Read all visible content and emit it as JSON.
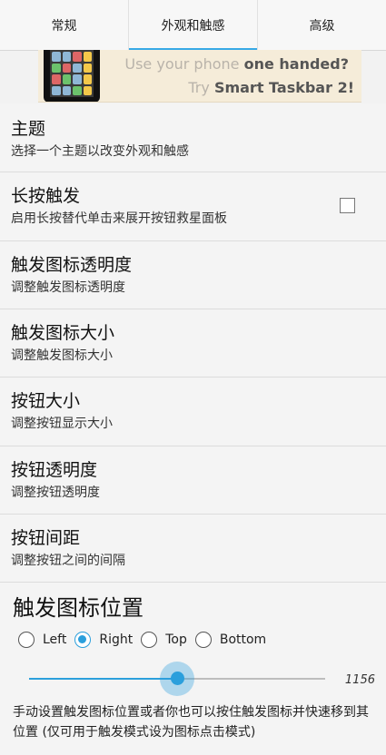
{
  "tabs": [
    {
      "label": "常规",
      "active": false
    },
    {
      "label": "外观和触感",
      "active": true
    },
    {
      "label": "高级",
      "active": false
    }
  ],
  "banner": {
    "line1_prefix": "Use your phone ",
    "line1_bold": "one handed?",
    "line2_prefix": "Try ",
    "line2_bold": "Smart Taskbar 2!"
  },
  "settings": [
    {
      "title": "主题",
      "subtitle": "选择一个主题以改变外观和触感"
    },
    {
      "title": "长按触发",
      "subtitle": "启用长按替代单击来展开按钮救星面板",
      "checkbox": false
    },
    {
      "title": "触发图标透明度",
      "subtitle": "调整触发图标透明度"
    },
    {
      "title": "触发图标大小",
      "subtitle": "调整触发图标大小"
    },
    {
      "title": "按钮大小",
      "subtitle": "调整按钮显示大小"
    },
    {
      "title": "按钮透明度",
      "subtitle": "调整按钮透明度"
    },
    {
      "title": "按钮间距",
      "subtitle": "调整按钮之间的间隔"
    }
  ],
  "position_section": {
    "title": "触发图标位置",
    "options": [
      "Left",
      "Right",
      "Top",
      "Bottom"
    ],
    "selected": "Right",
    "slider_value": "1156",
    "slider_fraction": 0.5,
    "description": "手动设置触发图标位置或者你也可以按住触发图标并快速移到其位置 (仅可用于触发模式设为图标点击模式)"
  },
  "colors": {
    "accent": "#2b9fdc"
  }
}
